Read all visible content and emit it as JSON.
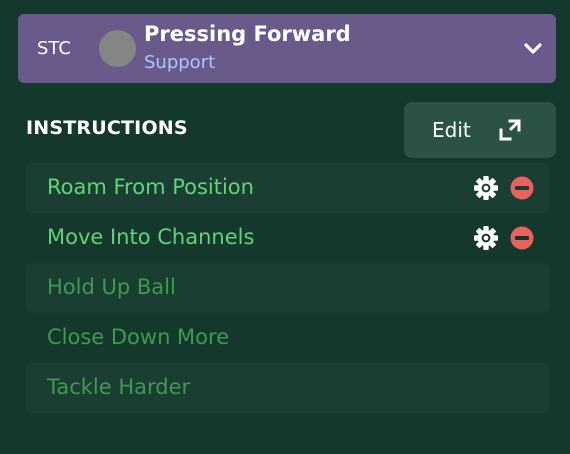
{
  "role": {
    "position_code": "STC",
    "role_name": "Pressing Forward",
    "duty": "Support"
  },
  "instructions": {
    "title": "INSTRUCTIONS",
    "edit_label": "Edit",
    "items": [
      {
        "label": "Roam From Position",
        "active": true
      },
      {
        "label": "Move Into Channels",
        "active": true
      },
      {
        "label": "Hold Up Ball",
        "active": false
      },
      {
        "label": "Close Down More",
        "active": false
      },
      {
        "label": "Tackle Harder",
        "active": false
      }
    ]
  },
  "colors": {
    "background": "#14382b",
    "header_purple": "#6a5a8c",
    "duty_blue": "#a9c6ff",
    "active_text": "#63d27a",
    "inactive_text": "#3f9a50",
    "remove_red": "#e8625e"
  },
  "icons": {
    "dropdown": "chevron-down-icon",
    "edit": "expand-icon",
    "settings": "gear-icon",
    "remove": "remove-icon"
  }
}
